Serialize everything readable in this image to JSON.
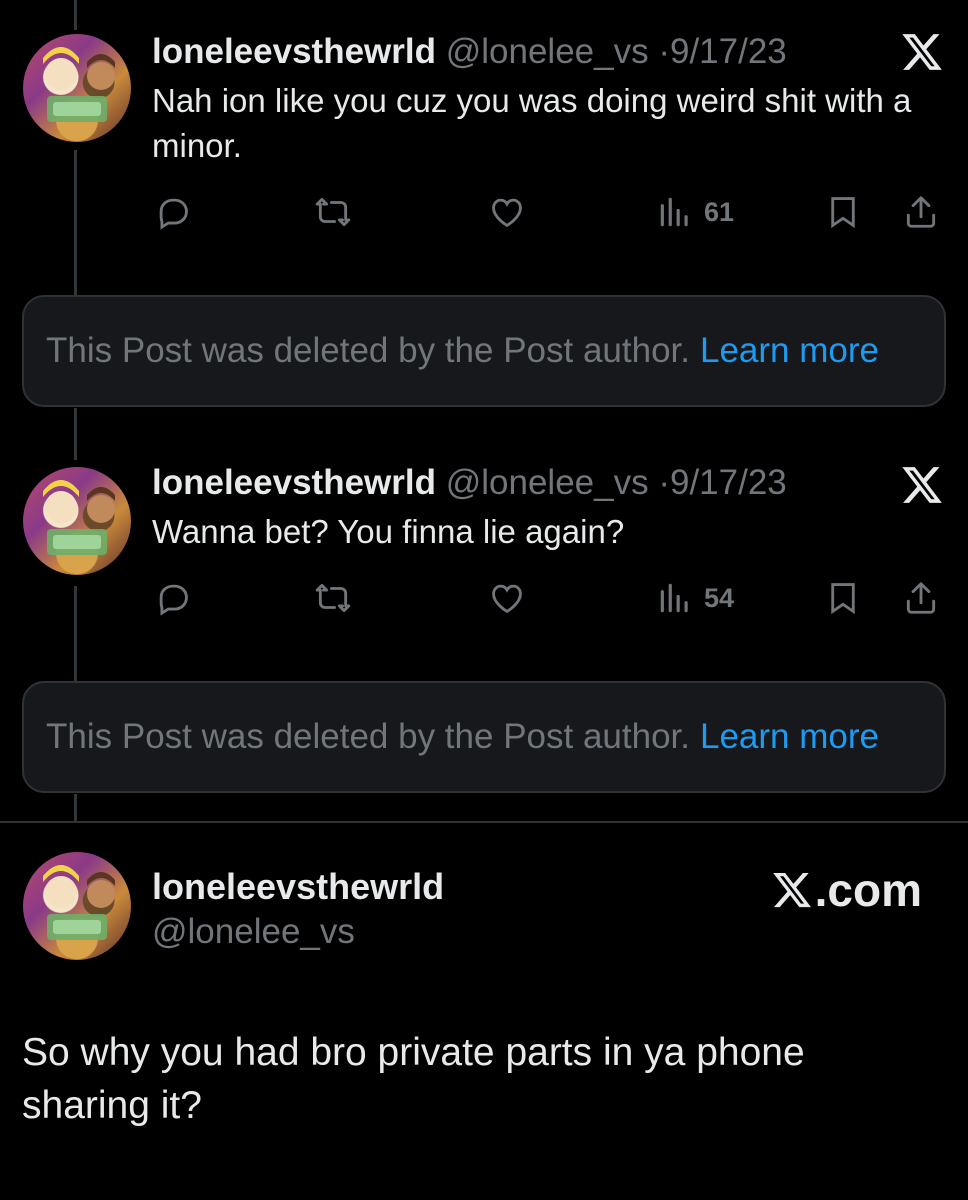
{
  "posts": [
    {
      "display_name": "loneleevsthewrld",
      "handle": "@lonelee_vs",
      "separator": "·",
      "date": "9/17/23",
      "text": "Nah ion like you cuz you was doing weird shit with a minor.",
      "views": "61",
      "platform_icon": "x-logo-icon"
    },
    {
      "display_name": "loneleevsthewrld",
      "handle": "@lonelee_vs",
      "separator": "·",
      "date": "9/17/23",
      "text": "Wanna bet? You finna lie again?",
      "views": "54",
      "platform_icon": "x-logo-icon"
    }
  ],
  "deleted_notices": [
    {
      "text": "This Post was deleted by the Post author.",
      "link": "Learn more"
    },
    {
      "text": "This Post was deleted by the Post author.",
      "link": "Learn more"
    }
  ],
  "card": {
    "display_name": "loneleevsthewrld",
    "handle": "@lonelee_vs",
    "brand": ".com",
    "text": "So why you had bro private parts in ya phone sharing it?"
  },
  "icons": [
    "reply-icon",
    "repost-icon",
    "like-icon",
    "views-icon",
    "bookmark-icon",
    "share-icon"
  ],
  "colors": {
    "background": "#000000",
    "text": "#e7e9ea",
    "muted": "#71767b",
    "link": "#1d9bf0",
    "border": "#2f3336"
  }
}
